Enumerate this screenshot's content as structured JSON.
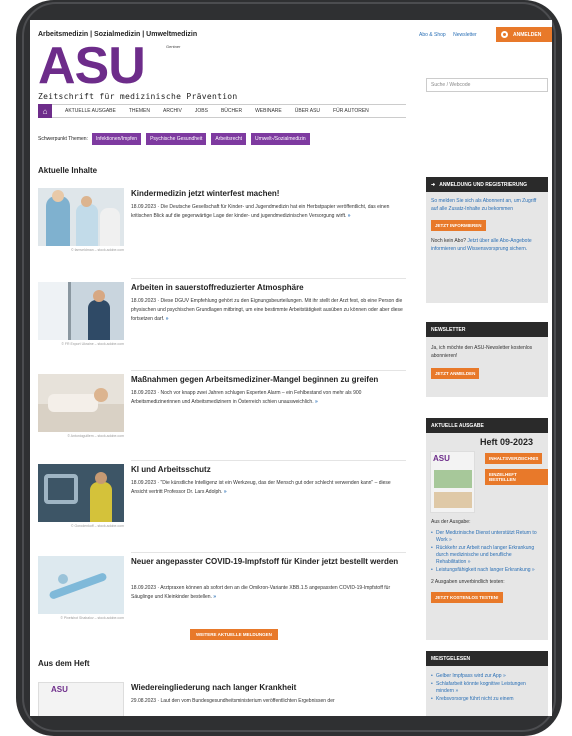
{
  "header": {
    "site_tag": "Arbeitsmedizin | Sozialmedizin | Umweltmedizin",
    "links": [
      "Abo & Shop",
      "Newsletter"
    ],
    "login": "ANMELDEN",
    "logo_text": "ASU",
    "logo_sub": "Gentner",
    "tagline": "Zeitschrift für medizinische Prävention",
    "search_placeholder": "Suche / Webcode"
  },
  "nav": {
    "items": [
      "Aktuelle Ausgabe",
      "Themen",
      "Archiv",
      "Jobs",
      "Bücher",
      "Webinare",
      "Über ASU",
      "Für Autoren"
    ]
  },
  "topics": {
    "label": "Schwerpunkt Themen:",
    "pills": [
      "Infektionen/Impfen",
      "Psychische Gesundheit",
      "Arbeitsrecht",
      "Umwelt-/Sozialmedizin"
    ]
  },
  "main": {
    "section_title": "Aktuelle Inhalte",
    "articles": [
      {
        "title": "Kindermedizin jetzt winterfest machen!",
        "text": "18.09.2023 · Die Deutsche Gesellschaft für Kinder- und Jugendmedizin hat ein Herbstpapier veröffentlicht, das einen kritischen Blick auf die gegenwärtige Lage der kinder- und jugendmedizinischen Versorgung wirft.",
        "credit": "© famveldman – stock.adobe.com"
      },
      {
        "title": "Arbeiten in sauerstoffreduzierter Atmosphäre",
        "text": "18.09.2023 · Diese DGUV Empfehlung gehört zu den Eignungsbeurteilungen. Mit ihr stellt der Arzt fest, ob eine Person die physischen und psychischen Grundlagen mitbringt, um eine bestimmte Arbeitstätigkeit ausüben zu können oder aber diese fortsetzen darf.",
        "credit": "© FR Export Ukraine – stock.adobe.com"
      },
      {
        "title": "Maßnahmen gegen Arbeitsmediziner-Mangel beginnen zu greifen",
        "text": "18.09.2023 · Noch vor knapp zwei Jahren schlugen Experten Alarm – ein Fehlbestand von mehr als 900 Arbeitsmedizinerinnen und Arbeitsmedizinern in Österreich schien unausweichlich.",
        "credit": "© Antonioguillem – stock.adobe.com"
      },
      {
        "title": "KI und Arbeitsschutz",
        "text": "18.09.2023 · \"Die künstliche Intelligenz ist ein Werkzeug, das der Mensch gut oder schlecht verwenden kann\" – diese Ansicht vertritt Professor Dr. Lars Adolph.",
        "credit": "© Gorodenkoff – stock.adobe.com"
      },
      {
        "title": "Neuer angepasster COVID-19-Impfstoff für Kinder jetzt bestellt werden",
        "text": "18.09.2023 · Arztpraxen können ab sofort den an die Omikron-Variante XBB.1.5 angepassten COVID-19-Impfstoff für Säuglinge und Kleinkinder bestellen.",
        "credit": "© Pixelshot Shabalov – stock.adobe.com"
      }
    ],
    "more_button": "WEITERE AKTUELLE MELDUNGEN",
    "section2_title": "Aus dem Heft",
    "heft_article": {
      "title": "Wiedereingliederung nach langer Krankheit",
      "text": "29.08.2023 · Laut den vom Bundesgesundheitsministerium veröffentlichten Ergebnissen der"
    }
  },
  "sidebar": {
    "login_box": {
      "title": "ANMELDUNG UND REGISTRIERUNG",
      "text": "So melden Sie sich als Abonnent an, um Zugriff auf alle Zusatz-Inhalte zu bekommen",
      "button": "JETZT INFORMIEREN",
      "text2_prefix": "Noch kein Abo?",
      "text2_link": "Jetzt über alle Abo-Angebote informieren und Wissensvorsprung sichern."
    },
    "newsletter": {
      "title": "NEWSLETTER",
      "text": "Ja, ich möchte den ASU-Newsletter kostenlos abonnieren!",
      "button": "JETZT ANMELDEN"
    },
    "issue": {
      "title": "AKTUELLE AUSGABE",
      "heft": "Heft 09-2023",
      "btn1": "INHALTSVERZEICHNIS",
      "btn2": "EINZELHEFT BESTELLEN",
      "from_label": "Aus der Ausgabe:",
      "items": [
        "Der Medizinische Dienst unterstützt Return to Work",
        "Rückkehr zur Arbeit nach langer Erkrankung durch medizinische und berufliche Rehabilitation",
        "Leistungsfähigkeit nach langer Erkrankung"
      ],
      "trial_text": "2 Ausgaben unverbindlich testen:",
      "trial_btn": "JETZT KOSTENLOS TESTEN!"
    },
    "popular": {
      "title": "MEISTGELESEN",
      "items": [
        "Gelber Impfpass wird zur App",
        "Schlafarbeit könnte kognitive Leistungen mindern",
        "Krebsvorsorge führt nicht zu einem"
      ]
    }
  }
}
